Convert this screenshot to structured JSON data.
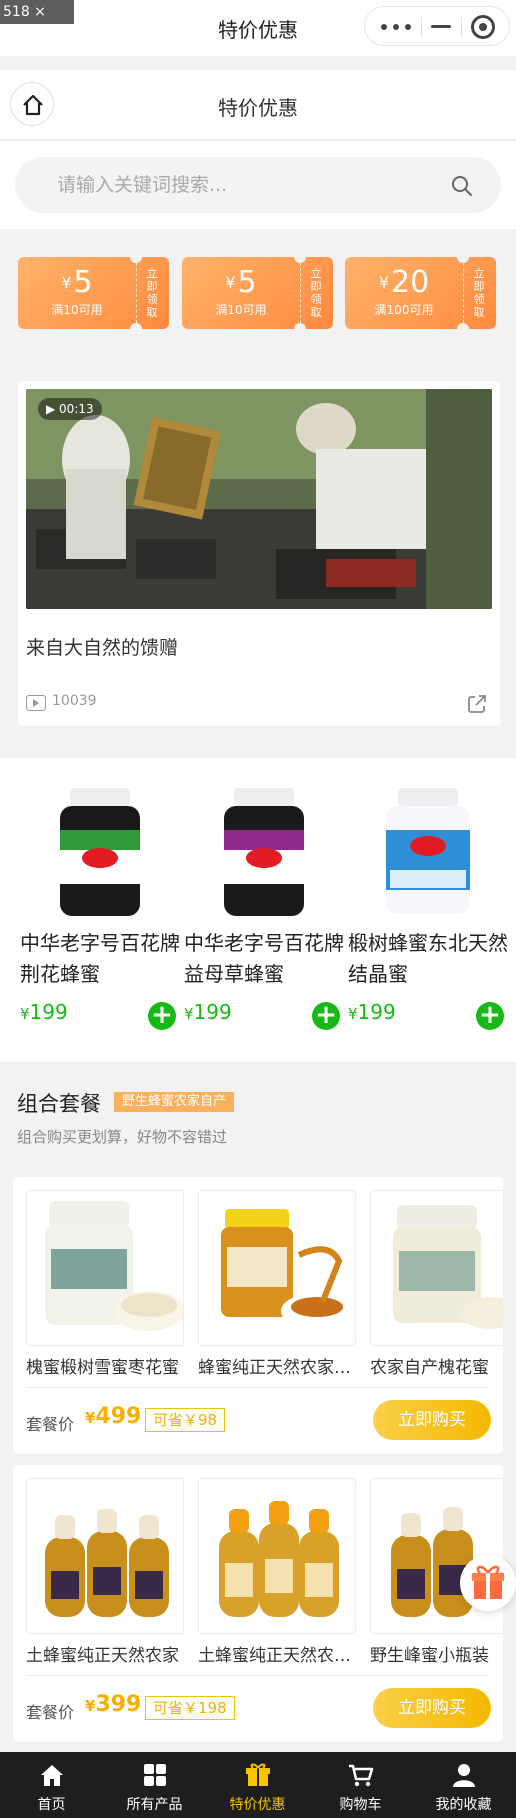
{
  "window": {
    "size_badge": "518 × 975",
    "title": "特价优惠"
  },
  "navbar": {
    "title": "特价优惠"
  },
  "search": {
    "placeholder": "请输入关键词搜索..."
  },
  "coupons": [
    {
      "currency": "¥",
      "amount": "5",
      "condition": "满10可用",
      "action": "立即领取"
    },
    {
      "currency": "¥",
      "amount": "5",
      "condition": "满10可用",
      "action": "立即领取"
    },
    {
      "currency": "¥",
      "amount": "20",
      "condition": "满100可用",
      "action": "立即领取"
    }
  ],
  "video": {
    "duration": "00:13",
    "title": "来自大自然的馈赠",
    "views": "10039"
  },
  "products": [
    {
      "name": "中华老字号百花牌荆花蜂蜜",
      "currency": "¥",
      "price": "199",
      "jar_color": "#2e9a3a"
    },
    {
      "name": "中华老字号百花牌益母草蜂蜜",
      "currency": "¥",
      "price": "199",
      "jar_color": "#8e2b8c"
    },
    {
      "name": "椴树蜂蜜东北天然结晶蜜",
      "currency": "¥",
      "price": "199",
      "jar_color": "#2f8fd6"
    }
  ],
  "combo": {
    "title": "组合套餐",
    "tag": "野生蜂蜜农家自产",
    "subtitle": "组合购买更划算，好物不容错过"
  },
  "packages": [
    {
      "items": [
        "槐蜜椴树雪蜜枣花蜜",
        "蜂蜜纯正天然农家自产",
        "农家自产槐花蜜"
      ],
      "label": "套餐价",
      "currency": "¥",
      "price": "499",
      "save": "可省￥98",
      "button": "立即购买"
    },
    {
      "items": [
        "土蜂蜜纯正天然农家",
        "土蜂蜜纯正天然农家自产",
        "野生峰蜜小瓶装"
      ],
      "label": "套餐价",
      "currency": "¥",
      "price": "399",
      "save": "可省￥198",
      "button": "立即购买"
    }
  ],
  "tabs": [
    {
      "label": "首页",
      "icon": "home-icon"
    },
    {
      "label": "所有产品",
      "icon": "grid-icon"
    },
    {
      "label": "特价优惠",
      "icon": "gift-icon",
      "active": true
    },
    {
      "label": "购物车",
      "icon": "cart-icon"
    },
    {
      "label": "我的收藏",
      "icon": "user-icon"
    }
  ],
  "colors": {
    "accent_green": "#16b916",
    "accent_gold": "#f6b100",
    "coupon_orange": "#ff8a3d",
    "tab_bg": "#1e1e1e"
  }
}
